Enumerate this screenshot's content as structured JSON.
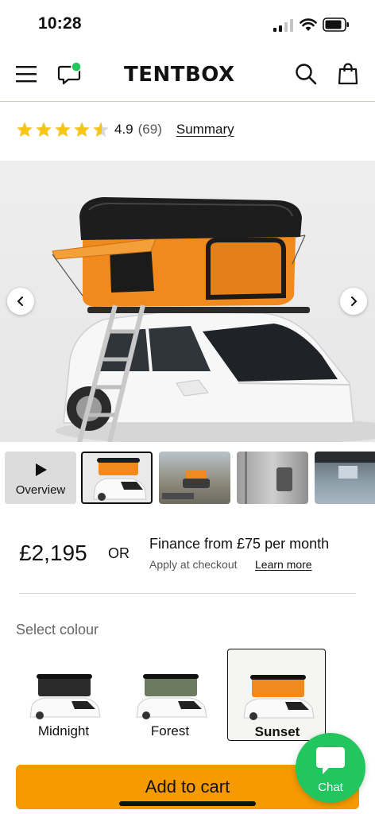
{
  "status_bar": {
    "time": "10:28"
  },
  "header": {
    "logo_text": "TENTBOX",
    "icons": [
      "menu-icon",
      "chat-icon",
      "search-icon",
      "bag-icon"
    ]
  },
  "rating": {
    "value": "4.9",
    "count": "(69)",
    "summary_label": "Summary",
    "stars": 4.5
  },
  "gallery": {
    "thumbnails": [
      {
        "label": "Overview",
        "selected": false
      },
      {
        "label": "",
        "selected": true
      },
      {
        "label": "",
        "selected": false
      },
      {
        "label": "",
        "selected": false
      },
      {
        "label": "",
        "selected": false
      }
    ]
  },
  "pricing": {
    "price": "£2,195",
    "or_label": "OR",
    "finance_text": "Finance from £75 per month",
    "apply_text": "Apply at checkout",
    "learn_more": "Learn more"
  },
  "colours": {
    "label": "Select colour",
    "options": [
      {
        "name": "Midnight",
        "colour": "#2b2b2b",
        "selected": false
      },
      {
        "name": "Forest",
        "colour": "#6b7a5e",
        "selected": false
      },
      {
        "name": "Sunset",
        "colour": "#f08a1c",
        "selected": true
      }
    ]
  },
  "cta": {
    "add_to_cart": "Add to cart"
  },
  "chat": {
    "label": "Chat"
  },
  "theme": {
    "accent": "#f59a00",
    "chat_green": "#22c55e",
    "star": "#f5c518",
    "tent_orange": "#f08a1c"
  }
}
